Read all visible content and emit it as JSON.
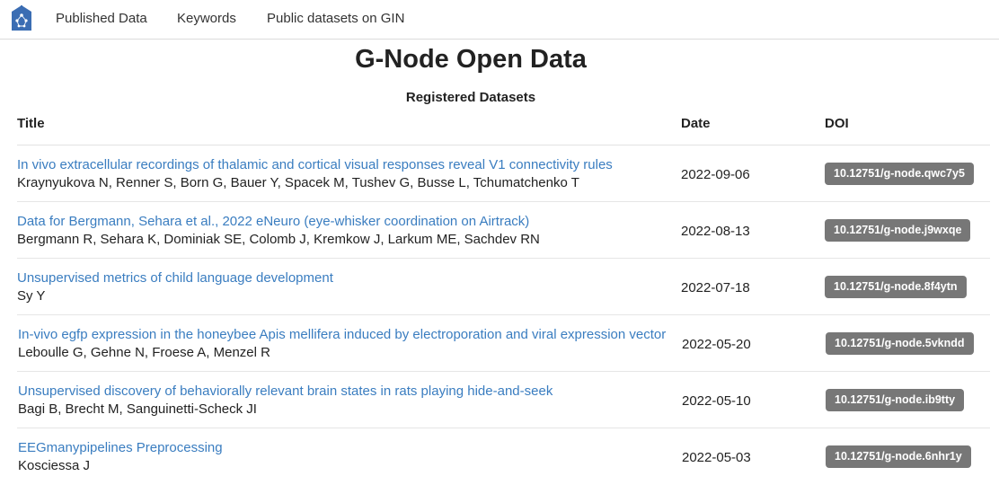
{
  "nav": {
    "items": [
      {
        "label": "Published Data"
      },
      {
        "label": "Keywords"
      },
      {
        "label": "Public datasets on GIN"
      }
    ]
  },
  "page": {
    "title": "G-Node Open Data",
    "subtitle": "Registered Datasets"
  },
  "table": {
    "headers": {
      "title": "Title",
      "date": "Date",
      "doi": "DOI"
    },
    "rows": [
      {
        "title": "In vivo extracellular recordings of thalamic and cortical visual responses reveal V1 connectivity rules",
        "authors": "Kraynyukova N, Renner S, Born G, Bauer Y, Spacek M, Tushev G, Busse L, Tchumatchenko T",
        "date": "2022-09-06",
        "doi": "10.12751/g-node.qwc7y5"
      },
      {
        "title": "Data for Bergmann, Sehara et al., 2022 eNeuro (eye-whisker coordination on Airtrack)",
        "authors": "Bergmann R, Sehara K, Dominiak SE, Colomb J, Kremkow J, Larkum ME, Sachdev RN",
        "date": "2022-08-13",
        "doi": "10.12751/g-node.j9wxqe"
      },
      {
        "title": "Unsupervised metrics of child language development",
        "authors": "Sy Y",
        "date": "2022-07-18",
        "doi": "10.12751/g-node.8f4ytn"
      },
      {
        "title": "In-vivo egfp expression in the honeybee Apis mellifera induced by electroporation and viral expression vector",
        "authors": "Leboulle G, Gehne N, Froese A, Menzel R",
        "date": "2022-05-20",
        "doi": "10.12751/g-node.5vkndd"
      },
      {
        "title": "Unsupervised discovery of behaviorally relevant brain states in rats playing hide-and-seek",
        "authors": "Bagi B, Brecht M, Sanguinetti-Scheck JI",
        "date": "2022-05-10",
        "doi": "10.12751/g-node.ib9tty"
      },
      {
        "title": "EEGmanypipelines Preprocessing",
        "authors": "Kosciessa J",
        "date": "2022-05-03",
        "doi": "10.12751/g-node.6nhr1y"
      }
    ]
  },
  "colors": {
    "link": "#3a7dc0",
    "badge": "#777777",
    "logo": "#3b6db3"
  }
}
